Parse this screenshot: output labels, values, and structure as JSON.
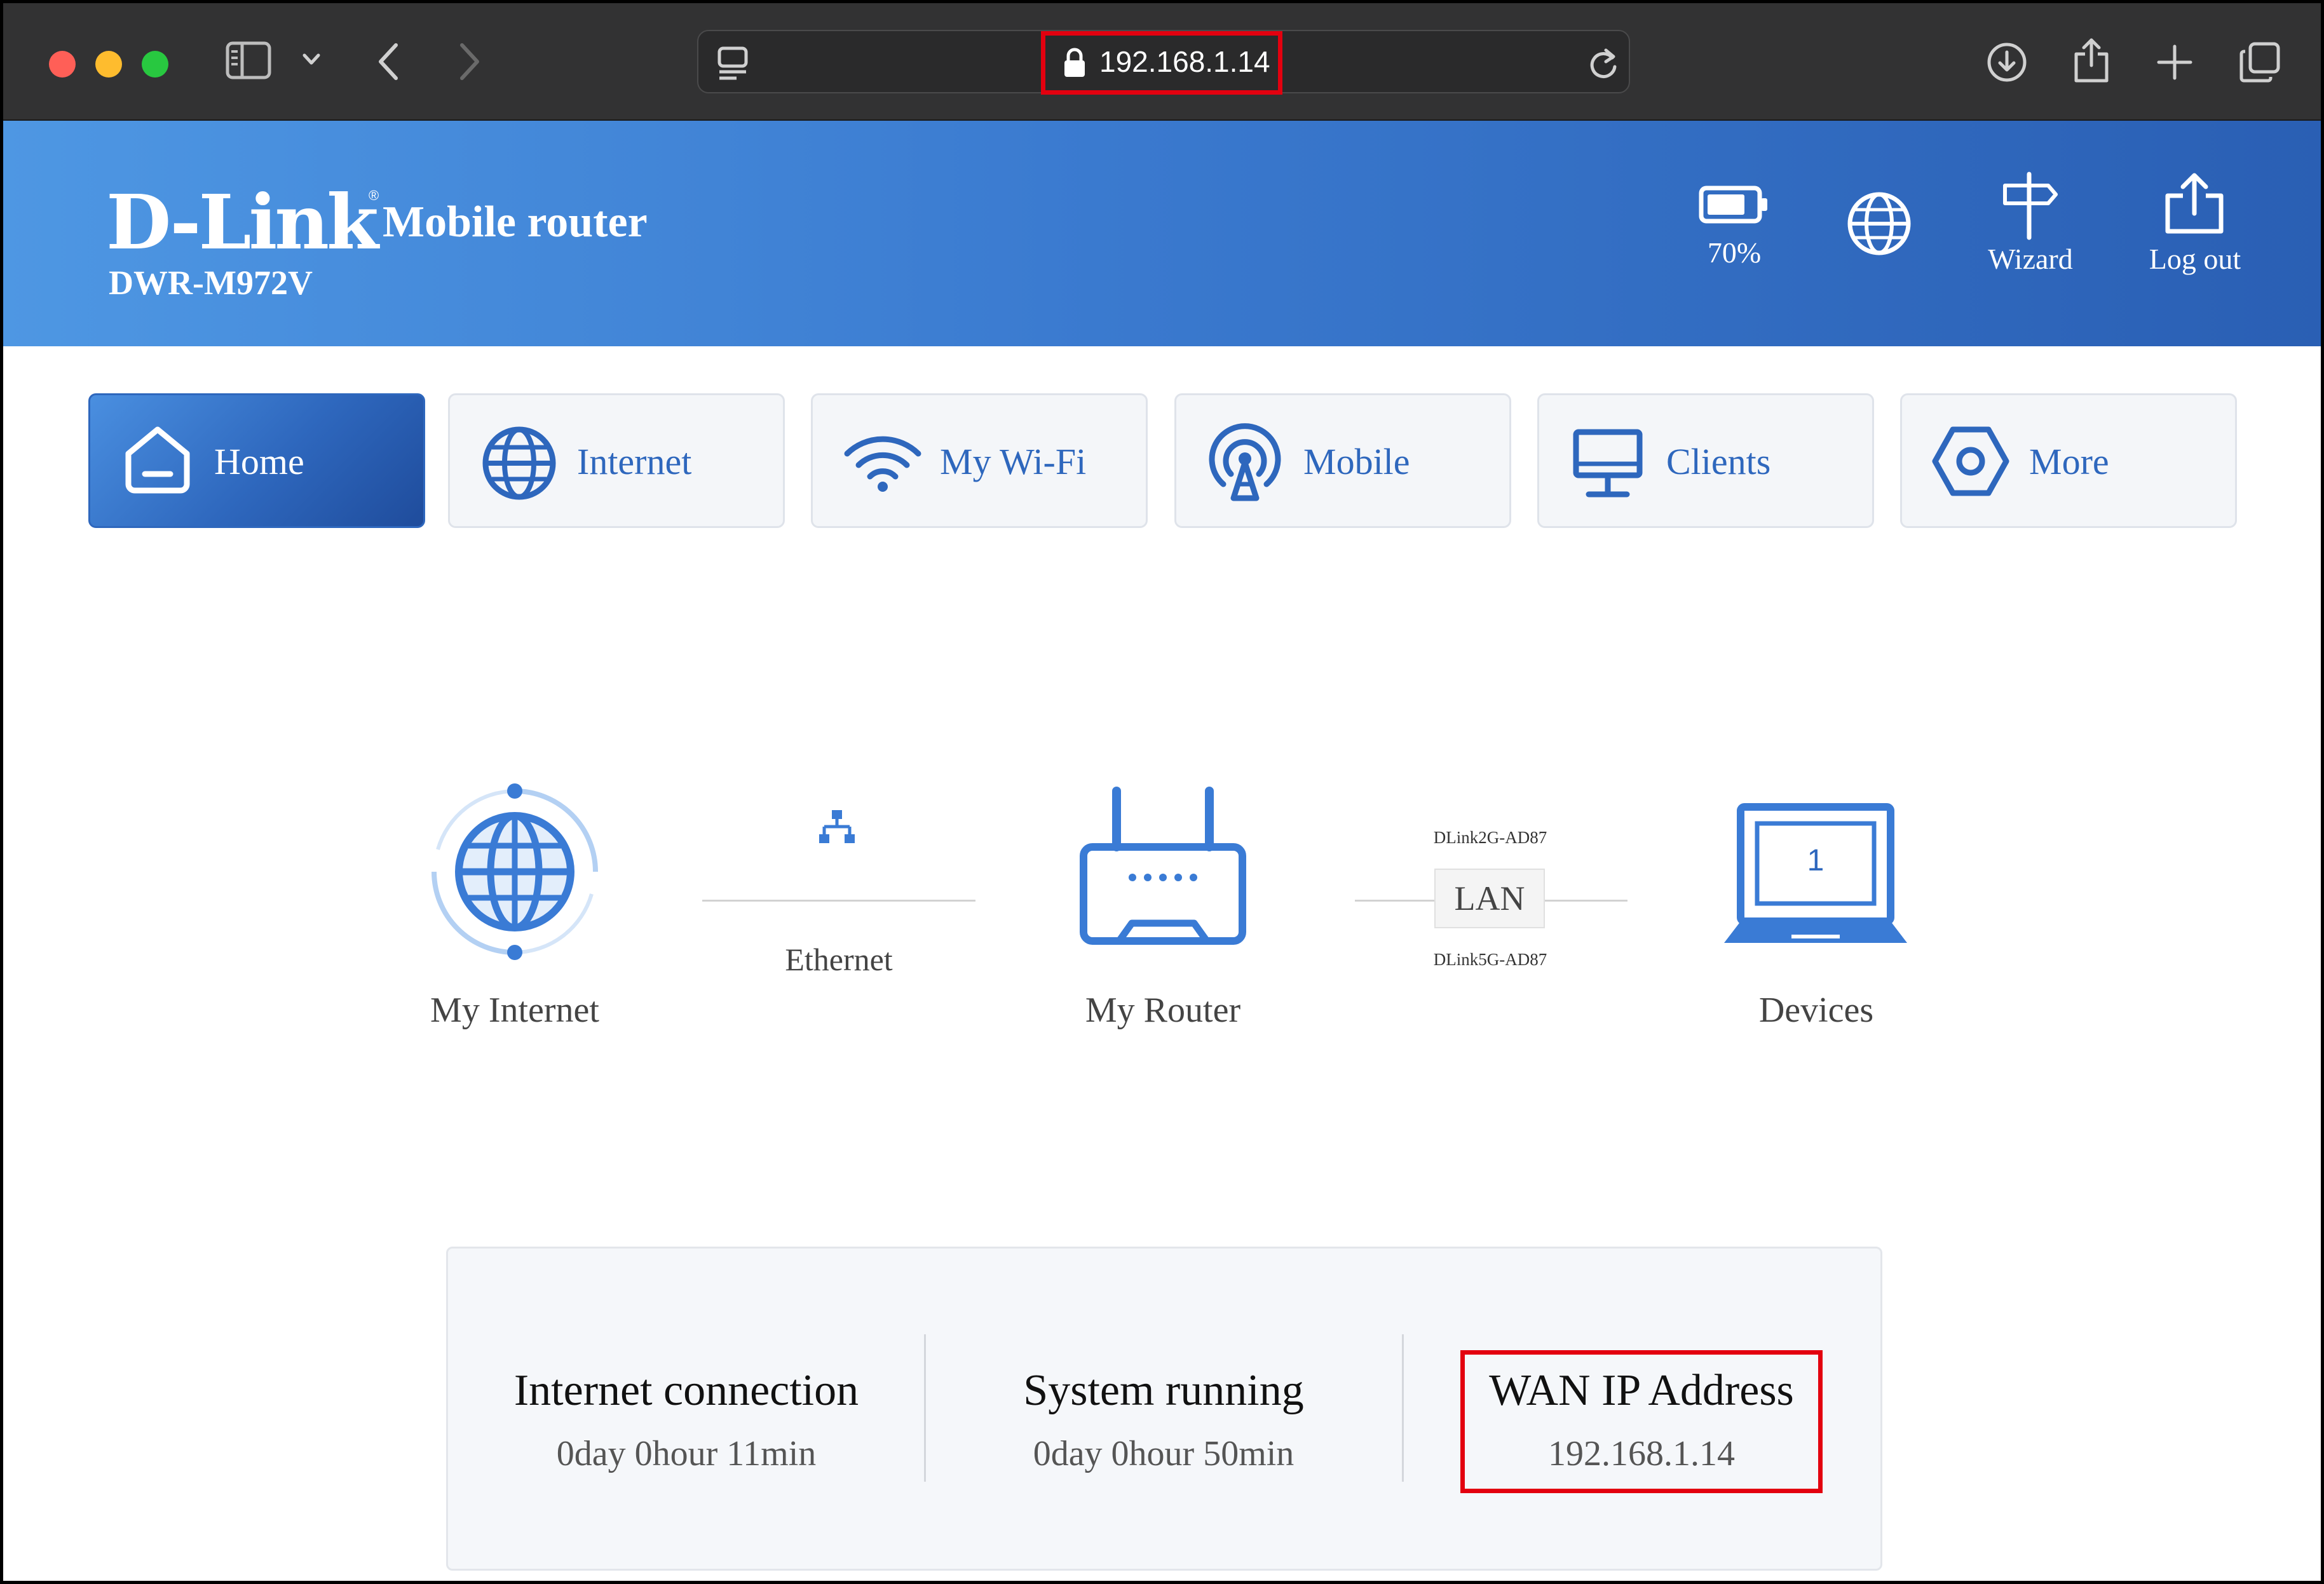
{
  "browser": {
    "url": "192.168.1.14",
    "icons": [
      "sidebar-icon",
      "chevron-down-icon",
      "back-icon",
      "forward-icon",
      "page-menu-icon",
      "lock-icon",
      "reload-icon",
      "download-icon",
      "share-icon",
      "new-tab-icon",
      "tabs-overview-icon"
    ],
    "highlight_color": "#e3000f"
  },
  "header": {
    "brand": "D-Link",
    "brand_mark": "®",
    "subtitle": "Mobile router",
    "model": "DWR-M972V",
    "battery_level": "70%",
    "wizard_label": "Wizard",
    "logout_label": "Log out",
    "gradient_colors": [
      "#4e97e3",
      "#2a5fb4"
    ]
  },
  "nav": {
    "tabs": [
      {
        "label": "Home",
        "icon": "home-icon",
        "active": true
      },
      {
        "label": "Internet",
        "icon": "globe-icon",
        "active": false
      },
      {
        "label": "My Wi-Fi",
        "icon": "wifi-icon",
        "active": false
      },
      {
        "label": "Mobile",
        "icon": "antenna-icon",
        "active": false
      },
      {
        "label": "Clients",
        "icon": "monitor-icon",
        "active": false
      },
      {
        "label": "More",
        "icon": "hexagon-icon",
        "active": false
      }
    ]
  },
  "topology": {
    "internet_label": "My Internet",
    "link_label": "Ethernet",
    "router_label": "My Router",
    "ssid_2g": "DLink2G-AD87",
    "lan_label": "LAN",
    "ssid_5g": "DLink5G-AD87",
    "device_count": "1",
    "devices_label": "Devices"
  },
  "status": {
    "internet_connection_title": "Internet connection",
    "internet_connection_value": "0day 0hour 11min",
    "system_running_title": "System running",
    "system_running_value": "0day 0hour 50min",
    "wan_ip_title": "WAN IP Address",
    "wan_ip_value": "192.168.1.14"
  }
}
